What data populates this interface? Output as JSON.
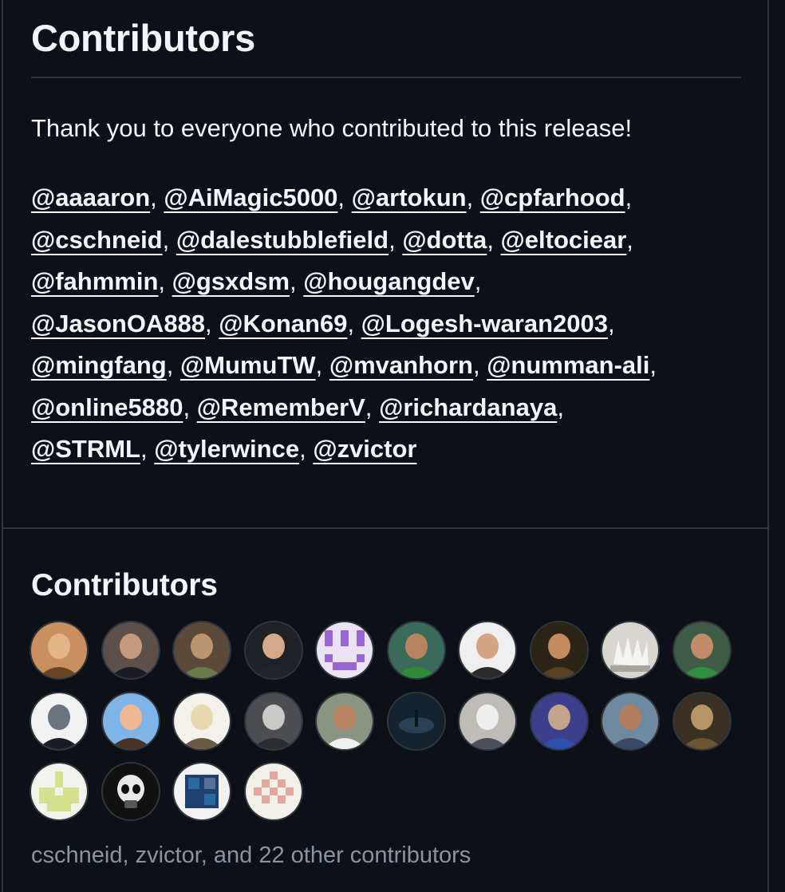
{
  "release_notes": {
    "heading": "Contributors",
    "thanks_text": "Thank you to everyone who contributed to this release!",
    "mention_lines": [
      [
        "@aaaaron",
        "@AiMagic5000",
        "@artokun",
        "@cpfarhood"
      ],
      [
        "@cschneid",
        "@dalestubblefield",
        "@dotta",
        "@eltociear"
      ],
      [
        "@fahmmin",
        "@gsxdsm",
        "@hougangdev"
      ],
      [
        "@JasonOA888",
        "@Konan69",
        "@Logesh-waran2003"
      ],
      [
        "@mingfang",
        "@MumuTW",
        "@mvanhorn",
        "@numman-ali"
      ],
      [
        "@online5880",
        "@RememberV",
        "@richardanaya"
      ],
      [
        "@STRML",
        "@tylerwince",
        "@zvictor"
      ]
    ]
  },
  "contributors_section": {
    "heading": "Contributors",
    "avatars": [
      {
        "icon": "animal-photo-avatar",
        "colors": [
          "#c98f5e",
          "#e2b486",
          "#6b4426"
        ]
      },
      {
        "icon": "man-beard-suit-avatar",
        "colors": [
          "#5d4f4a",
          "#c49a7c",
          "#1c1c24"
        ]
      },
      {
        "icon": "man-gray-hair-avatar",
        "colors": [
          "#5b4a3a",
          "#b99572",
          "#6b7a4a"
        ]
      },
      {
        "icon": "man-dark-hair-avatar",
        "colors": [
          "#1e2226",
          "#d3a98a",
          "#20252e"
        ]
      },
      {
        "icon": "purple-pixel-identicon",
        "colors": [
          "#e9e3f4",
          "#9b65d3",
          "#9b65d3"
        ]
      },
      {
        "icon": "man-green-jacket-avatar",
        "colors": [
          "#3a6a5a",
          "#b78461",
          "#2f8a3a"
        ]
      },
      {
        "icon": "man-glasses-white-avatar",
        "colors": [
          "#efefef",
          "#d4a383",
          "#2a2a2a"
        ]
      },
      {
        "icon": "man-cowboy-hat-avatar",
        "colors": [
          "#2d2418",
          "#c48b5e",
          "#5a4025"
        ]
      },
      {
        "icon": "white-sculpture-avatar",
        "colors": [
          "#d9d6d1",
          "#f4f4f2",
          "#a9a39a"
        ]
      },
      {
        "icon": "man-green-shirt-avatar",
        "colors": [
          "#3e5c46",
          "#c08b67",
          "#2f8f3f"
        ]
      },
      {
        "icon": "astronaut-cat-avatar",
        "colors": [
          "#f2f2f2",
          "#6a7480",
          "#1b1d22"
        ]
      },
      {
        "icon": "cartoon-man-avatar",
        "colors": [
          "#7fb4e8",
          "#f0b892",
          "#4a3226"
        ]
      },
      {
        "icon": "sketch-portrait-avatar",
        "colors": [
          "#f3f1ea",
          "#e8d8b0",
          "#6b5b45"
        ]
      },
      {
        "icon": "cat-photo-avatar",
        "colors": [
          "#4d4e52",
          "#c9c9c7",
          "#2c2d30"
        ]
      },
      {
        "icon": "man-smiling-avatar",
        "colors": [
          "#8a9480",
          "#b88462",
          "#f0f0f0"
        ]
      },
      {
        "icon": "dark-scene-avatar",
        "colors": [
          "#132430",
          "#39556a",
          "#0a141b"
        ]
      },
      {
        "icon": "cat-suit-avatar",
        "colors": [
          "#bfbcb7",
          "#eeeeee",
          "#4a4f58"
        ]
      },
      {
        "icon": "armored-character-avatar",
        "colors": [
          "#3b3f8c",
          "#c1a48a",
          "#2d4fae"
        ]
      },
      {
        "icon": "man-outdoor-avatar",
        "colors": [
          "#6e8aa0",
          "#b07e5c",
          "#3a4a66"
        ]
      },
      {
        "icon": "painted-portrait-avatar",
        "colors": [
          "#3a3124",
          "#b79666",
          "#6b5430"
        ]
      },
      {
        "icon": "green-pixel-identicon",
        "colors": [
          "#f3f3ee",
          "#d4e08c",
          "#d4e08c"
        ]
      },
      {
        "icon": "skull-avatar",
        "colors": [
          "#111111",
          "#e9e9e9",
          "#555555"
        ]
      },
      {
        "icon": "bm-logo-avatar",
        "colors": [
          "#f2f2f2",
          "#1f3f6e",
          "#2a6a9e"
        ]
      },
      {
        "icon": "pink-pixel-identicon",
        "colors": [
          "#f3efe9",
          "#e3a69c",
          "#e3a69c"
        ]
      }
    ],
    "summary": "cschneid, zvictor, and 22 other contributors"
  }
}
